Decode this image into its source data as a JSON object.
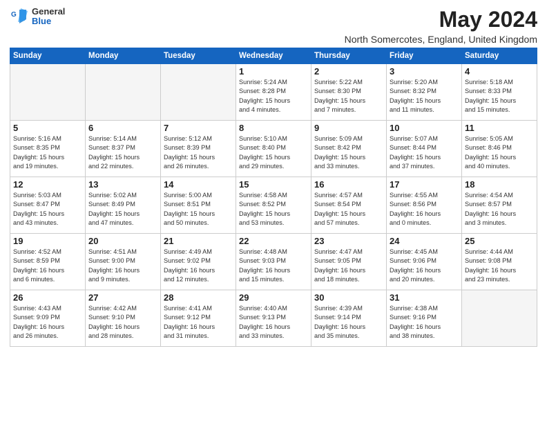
{
  "logo": {
    "general": "General",
    "blue": "Blue"
  },
  "title": "May 2024",
  "location": "North Somercotes, England, United Kingdom",
  "headers": [
    "Sunday",
    "Monday",
    "Tuesday",
    "Wednesday",
    "Thursday",
    "Friday",
    "Saturday"
  ],
  "weeks": [
    [
      {
        "day": "",
        "info": ""
      },
      {
        "day": "",
        "info": ""
      },
      {
        "day": "",
        "info": ""
      },
      {
        "day": "1",
        "info": "Sunrise: 5:24 AM\nSunset: 8:28 PM\nDaylight: 15 hours\nand 4 minutes."
      },
      {
        "day": "2",
        "info": "Sunrise: 5:22 AM\nSunset: 8:30 PM\nDaylight: 15 hours\nand 7 minutes."
      },
      {
        "day": "3",
        "info": "Sunrise: 5:20 AM\nSunset: 8:32 PM\nDaylight: 15 hours\nand 11 minutes."
      },
      {
        "day": "4",
        "info": "Sunrise: 5:18 AM\nSunset: 8:33 PM\nDaylight: 15 hours\nand 15 minutes."
      }
    ],
    [
      {
        "day": "5",
        "info": "Sunrise: 5:16 AM\nSunset: 8:35 PM\nDaylight: 15 hours\nand 19 minutes."
      },
      {
        "day": "6",
        "info": "Sunrise: 5:14 AM\nSunset: 8:37 PM\nDaylight: 15 hours\nand 22 minutes."
      },
      {
        "day": "7",
        "info": "Sunrise: 5:12 AM\nSunset: 8:39 PM\nDaylight: 15 hours\nand 26 minutes."
      },
      {
        "day": "8",
        "info": "Sunrise: 5:10 AM\nSunset: 8:40 PM\nDaylight: 15 hours\nand 29 minutes."
      },
      {
        "day": "9",
        "info": "Sunrise: 5:09 AM\nSunset: 8:42 PM\nDaylight: 15 hours\nand 33 minutes."
      },
      {
        "day": "10",
        "info": "Sunrise: 5:07 AM\nSunset: 8:44 PM\nDaylight: 15 hours\nand 37 minutes."
      },
      {
        "day": "11",
        "info": "Sunrise: 5:05 AM\nSunset: 8:46 PM\nDaylight: 15 hours\nand 40 minutes."
      }
    ],
    [
      {
        "day": "12",
        "info": "Sunrise: 5:03 AM\nSunset: 8:47 PM\nDaylight: 15 hours\nand 43 minutes."
      },
      {
        "day": "13",
        "info": "Sunrise: 5:02 AM\nSunset: 8:49 PM\nDaylight: 15 hours\nand 47 minutes."
      },
      {
        "day": "14",
        "info": "Sunrise: 5:00 AM\nSunset: 8:51 PM\nDaylight: 15 hours\nand 50 minutes."
      },
      {
        "day": "15",
        "info": "Sunrise: 4:58 AM\nSunset: 8:52 PM\nDaylight: 15 hours\nand 53 minutes."
      },
      {
        "day": "16",
        "info": "Sunrise: 4:57 AM\nSunset: 8:54 PM\nDaylight: 15 hours\nand 57 minutes."
      },
      {
        "day": "17",
        "info": "Sunrise: 4:55 AM\nSunset: 8:56 PM\nDaylight: 16 hours\nand 0 minutes."
      },
      {
        "day": "18",
        "info": "Sunrise: 4:54 AM\nSunset: 8:57 PM\nDaylight: 16 hours\nand 3 minutes."
      }
    ],
    [
      {
        "day": "19",
        "info": "Sunrise: 4:52 AM\nSunset: 8:59 PM\nDaylight: 16 hours\nand 6 minutes."
      },
      {
        "day": "20",
        "info": "Sunrise: 4:51 AM\nSunset: 9:00 PM\nDaylight: 16 hours\nand 9 minutes."
      },
      {
        "day": "21",
        "info": "Sunrise: 4:49 AM\nSunset: 9:02 PM\nDaylight: 16 hours\nand 12 minutes."
      },
      {
        "day": "22",
        "info": "Sunrise: 4:48 AM\nSunset: 9:03 PM\nDaylight: 16 hours\nand 15 minutes."
      },
      {
        "day": "23",
        "info": "Sunrise: 4:47 AM\nSunset: 9:05 PM\nDaylight: 16 hours\nand 18 minutes."
      },
      {
        "day": "24",
        "info": "Sunrise: 4:45 AM\nSunset: 9:06 PM\nDaylight: 16 hours\nand 20 minutes."
      },
      {
        "day": "25",
        "info": "Sunrise: 4:44 AM\nSunset: 9:08 PM\nDaylight: 16 hours\nand 23 minutes."
      }
    ],
    [
      {
        "day": "26",
        "info": "Sunrise: 4:43 AM\nSunset: 9:09 PM\nDaylight: 16 hours\nand 26 minutes."
      },
      {
        "day": "27",
        "info": "Sunrise: 4:42 AM\nSunset: 9:10 PM\nDaylight: 16 hours\nand 28 minutes."
      },
      {
        "day": "28",
        "info": "Sunrise: 4:41 AM\nSunset: 9:12 PM\nDaylight: 16 hours\nand 31 minutes."
      },
      {
        "day": "29",
        "info": "Sunrise: 4:40 AM\nSunset: 9:13 PM\nDaylight: 16 hours\nand 33 minutes."
      },
      {
        "day": "30",
        "info": "Sunrise: 4:39 AM\nSunset: 9:14 PM\nDaylight: 16 hours\nand 35 minutes."
      },
      {
        "day": "31",
        "info": "Sunrise: 4:38 AM\nSunset: 9:16 PM\nDaylight: 16 hours\nand 38 minutes."
      },
      {
        "day": "",
        "info": ""
      }
    ]
  ]
}
